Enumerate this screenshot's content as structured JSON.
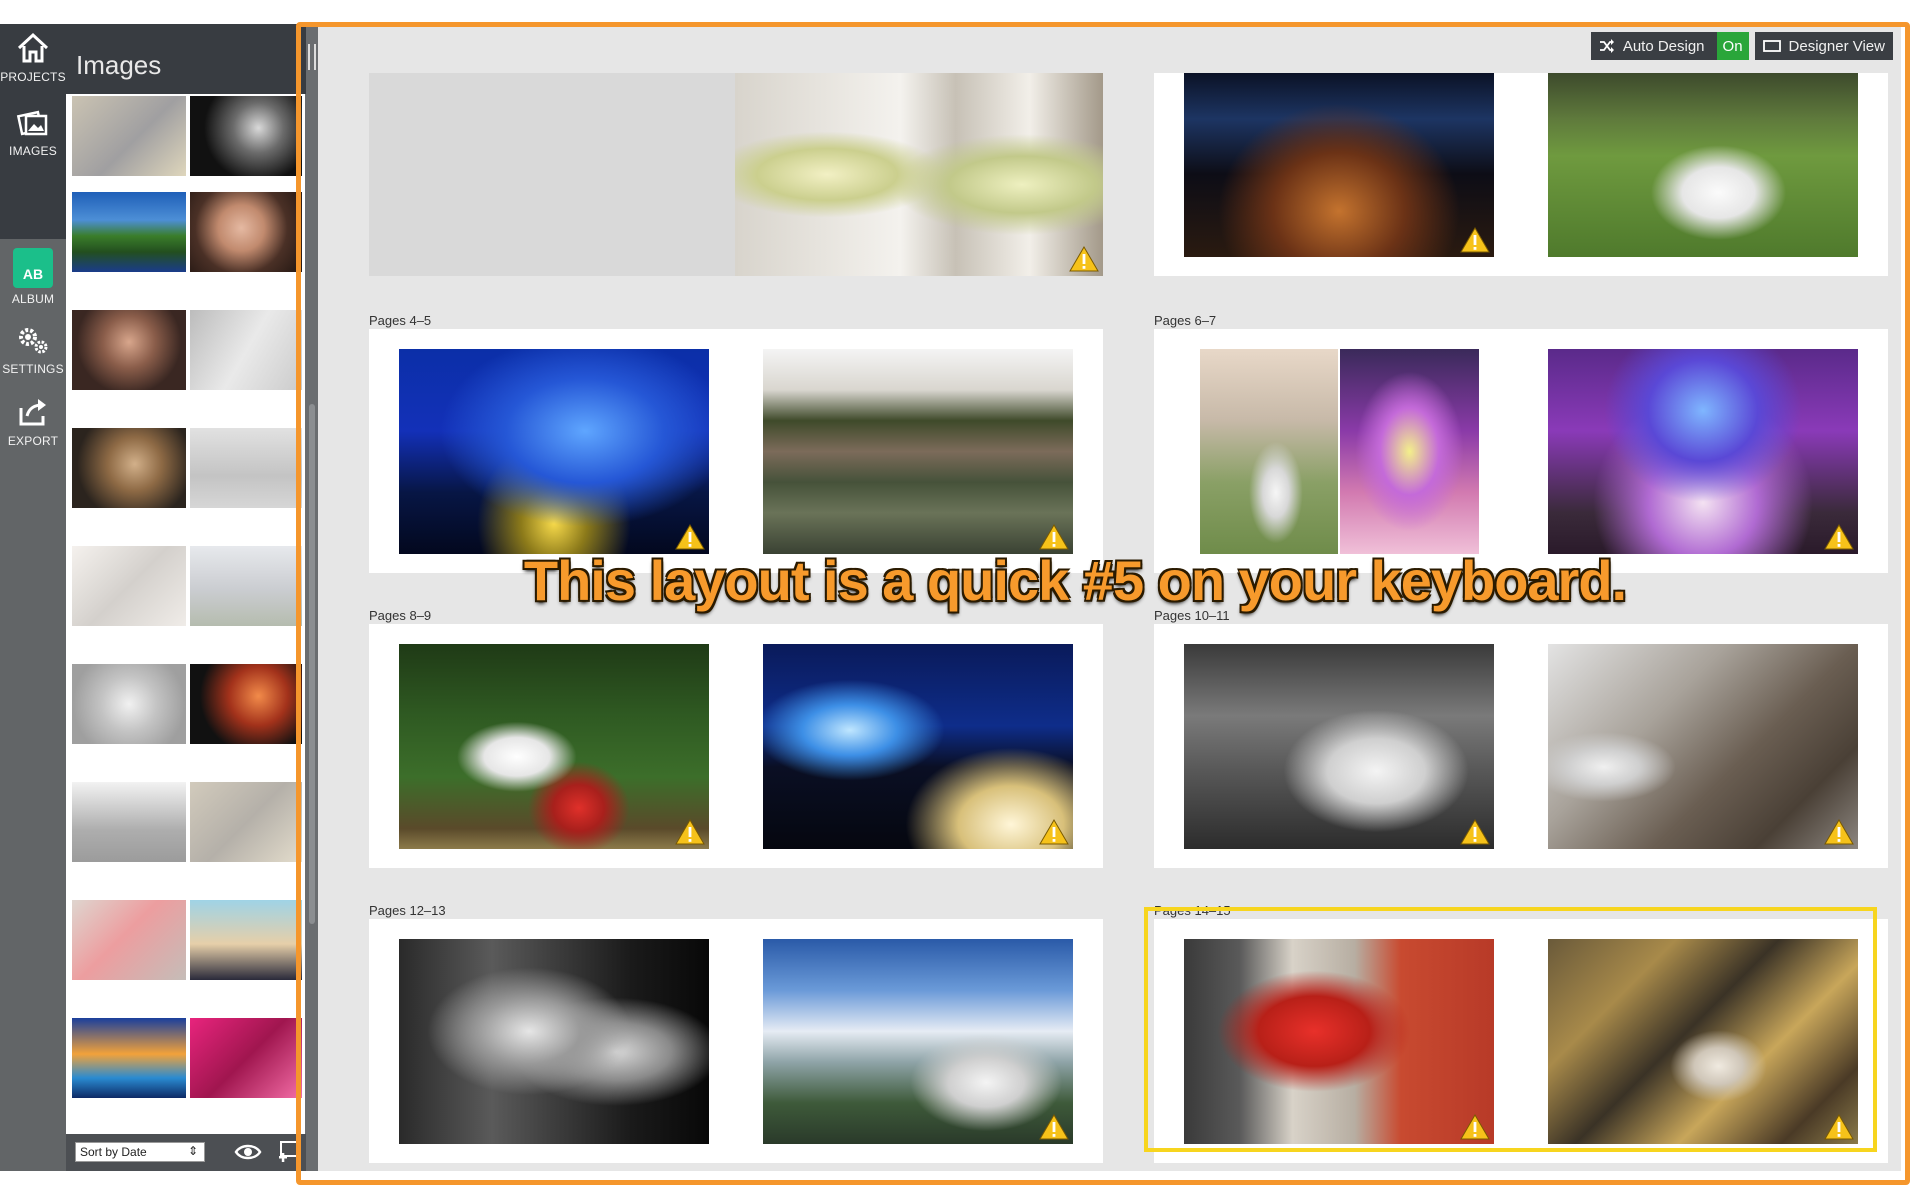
{
  "nav": {
    "projects_label": "PROJECTS",
    "images_label": "IMAGES",
    "album_badge": "AB",
    "album_label": "ALBUM",
    "settings_label": "SETTINGS",
    "export_label": "EXPORT"
  },
  "panel": {
    "title": "Images",
    "sort_value": "Sort by Date",
    "sort_arrow": "⇕"
  },
  "toolbar": {
    "auto_design_label": "Auto Design",
    "auto_design_state": "On",
    "designer_view_label": "Designer View"
  },
  "spreads": {
    "pages_4_5": "Pages 4–5",
    "pages_6_7": "Pages 6–7",
    "pages_8_9": "Pages 8–9",
    "pages_10_11": "Pages 10–11",
    "pages_12_13": "Pages 12–13",
    "pages_14_15": "Pages 14–15"
  },
  "annotation": {
    "caption": "This layout is a quick #5 on your keyboard."
  },
  "colors": {
    "highlight_orange": "#f5962c",
    "highlight_yellow": "#f7d51e",
    "auto_design_on": "#2aa63a",
    "album_accent": "#1bbf8a",
    "warning": "#f6c21a"
  }
}
